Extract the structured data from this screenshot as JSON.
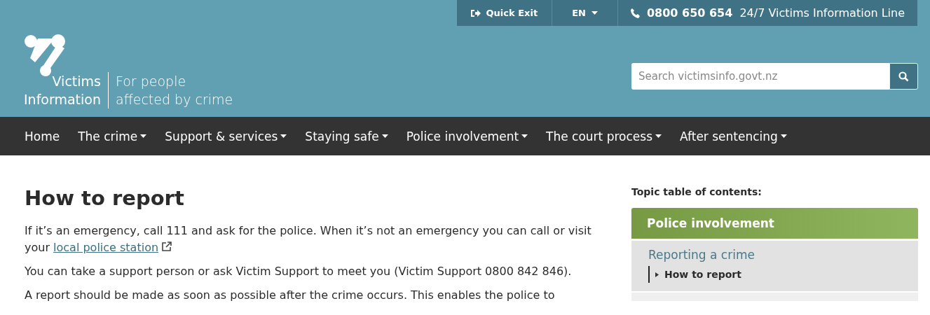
{
  "utility_bar": {
    "quick_exit": "Quick Exit",
    "language": "EN",
    "phone": "0800 650 654",
    "phone_label": "24/7 Victims Information Line"
  },
  "logo": {
    "name_line_1": "Victims",
    "name_line_2": "Information",
    "tagline_line_1": "For people",
    "tagline_line_2": "affected by crime"
  },
  "search": {
    "placeholder": "Search victimsinfo.govt.nz"
  },
  "nav": [
    {
      "label": "Home",
      "dropdown": false
    },
    {
      "label": "The crime",
      "dropdown": true
    },
    {
      "label": "Support & services",
      "dropdown": true
    },
    {
      "label": "Staying safe",
      "dropdown": true
    },
    {
      "label": "Police involvement",
      "dropdown": true
    },
    {
      "label": "The court process",
      "dropdown": true
    },
    {
      "label": "After sentencing",
      "dropdown": true
    }
  ],
  "page": {
    "title": "How to report",
    "paragraphs": [
      {
        "text": "If it’s an emergency, call 111 and ask for the police. When it’s not an emergency you can call or visit your",
        "link": "local police station"
      },
      {
        "text": "You can take a support person or ask Victim Support to meet you (Victim Support 0800 842 846)."
      },
      {
        "text": "A report should be made as soon as possible after the crime occurs. This enables the police to"
      }
    ]
  },
  "sidebar": {
    "heading": "Topic table of contents:",
    "sections": [
      {
        "label": "Police involvement",
        "children": [
          {
            "label": "Reporting a crime",
            "children": [
              {
                "label": "How to report",
                "selected": true
              }
            ]
          }
        ]
      }
    ]
  }
}
